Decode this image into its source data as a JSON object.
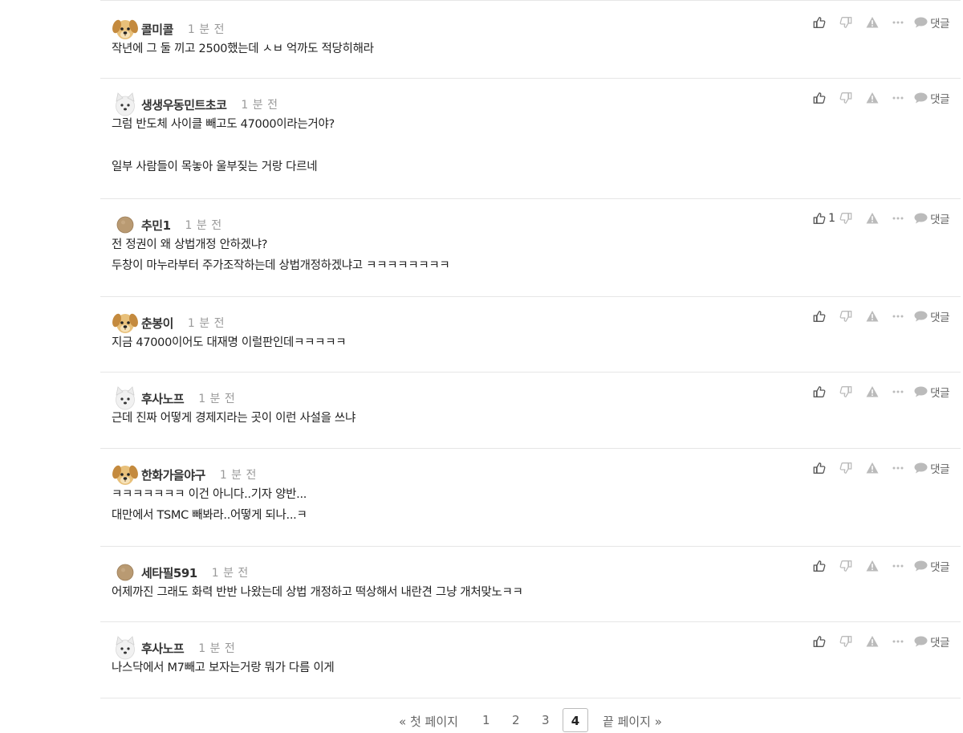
{
  "comments": [
    {
      "nickname": "콜미콜",
      "avatar": "puppy",
      "time": "1 분 전",
      "likes": "",
      "lines": [
        "작년에 그 둘 끼고 2500했는데 ㅅㅂ 억까도 적당히해라"
      ]
    },
    {
      "nickname": "생생우동민트초코",
      "avatar": "white-puppy",
      "time": "1 분 전",
      "likes": "",
      "lines": [
        "그럼 반도체 사이클 빼고도 47000이라는거야?",
        "",
        "일부 사람들이 목놓아 울부짖는 거랑 다르네"
      ]
    },
    {
      "nickname": "추민1",
      "avatar": "default",
      "time": "1 분 전",
      "likes": "1",
      "lines": [
        "전 정권이 왜 상법개정 안하겠냐?",
        "두창이 마누라부터 주가조작하는데 상법개정하겠냐고 ㅋㅋㅋㅋㅋㅋㅋㅋ"
      ]
    },
    {
      "nickname": "춘봉이",
      "avatar": "puppy",
      "time": "1 분 전",
      "likes": "",
      "lines": [
        "지금 47000이어도 대재명 이럴판인데ㅋㅋㅋㅋㅋ"
      ]
    },
    {
      "nickname": "후사노프",
      "avatar": "white-puppy",
      "time": "1 분 전",
      "likes": "",
      "lines": [
        "근데 진짜 어떻게 경제지라는 곳이 이런 사설을 쓰냐"
      ]
    },
    {
      "nickname": "한화가을야구",
      "avatar": "puppy",
      "time": "1 분 전",
      "likes": "",
      "lines": [
        "ㅋㅋㅋㅋㅋㅋㅋ 이건 아니다..기자 양반...",
        "대만에서 TSMC 빼봐라..어떻게 되나...ㅋ"
      ]
    },
    {
      "nickname": "세타필591",
      "avatar": "default",
      "time": "1 분 전",
      "likes": "",
      "lines": [
        "어제까진 그래도 화력 반반 나왔는데 상법 개정하고 떡상해서 내란견 그냥 개처맞노ㅋㅋ"
      ]
    },
    {
      "nickname": "후사노프",
      "avatar": "white-puppy",
      "time": "1 분 전",
      "likes": "",
      "lines": [
        "나스닥에서 M7빼고 보자는거랑 뭐가 다름 이게"
      ]
    }
  ],
  "actions": {
    "reply_label": "댓글"
  },
  "pagination": {
    "first_label": "« 첫 페이지",
    "pages": [
      "1",
      "2",
      "3",
      "4"
    ],
    "current": "4",
    "last_label": "끝 페이지 »"
  },
  "colors": {
    "divider": "#e6e6e6",
    "icon": "#555555",
    "icon_muted": "#bbbbbb",
    "time_text": "#9a9a9a"
  }
}
